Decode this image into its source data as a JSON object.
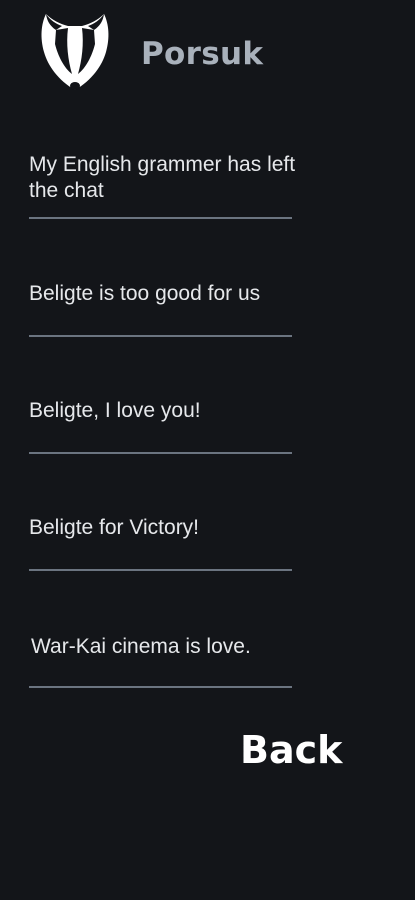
{
  "header": {
    "app_title": "Porsuk",
    "logo_icon": "badger-icon"
  },
  "messages": [
    {
      "text": "My English grammer has left the chat"
    },
    {
      "text": "Beligte is too good for us"
    },
    {
      "text": "Beligte, I love you!"
    },
    {
      "text": "Beligte for Victory!"
    },
    {
      "text": "War-Kai cinema is love."
    }
  ],
  "footer": {
    "back_label": "Back"
  },
  "colors": {
    "background": "#131519",
    "title": "#a9b1bb",
    "text": "#e6e8eb",
    "divider": "#6b7480"
  }
}
